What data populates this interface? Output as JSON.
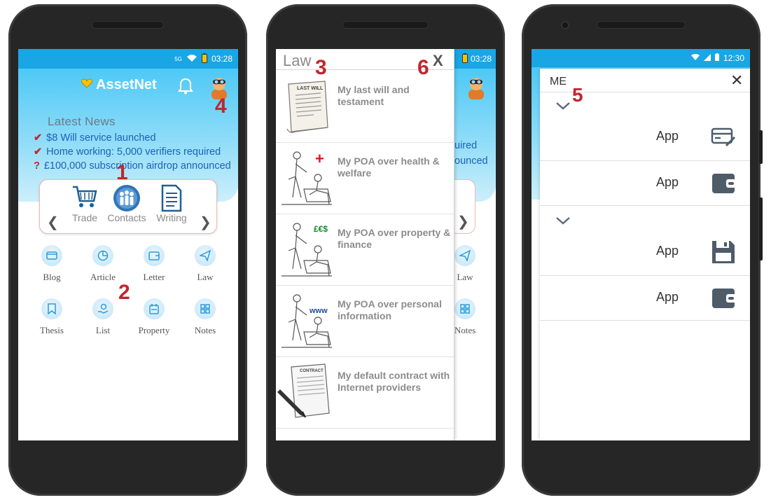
{
  "phone1": {
    "status": {
      "network": "5G",
      "time": "03:28"
    },
    "header": {
      "app_name": "AssetNet"
    },
    "news": {
      "title": "Latest News",
      "items": [
        {
          "marker": "✔",
          "text": "$8 Will service launched"
        },
        {
          "marker": "✔",
          "text": "Home working: 5,000 verifiers required"
        },
        {
          "marker": "?",
          "text": "£100,000 subscription airdrop announced"
        }
      ]
    },
    "carousel": {
      "items": [
        "Trade",
        "Contacts",
        "Writing"
      ],
      "prev": "❮",
      "next": "❯"
    },
    "grid": [
      "Blog",
      "Article",
      "Letter",
      "Law",
      "Thesis",
      "List",
      "Property",
      "Notes"
    ],
    "callouts": {
      "one": "1",
      "two": "2",
      "four": "4"
    }
  },
  "phone2": {
    "status": {
      "time": "03:28"
    },
    "drawer": {
      "title": "Law",
      "close": "X"
    },
    "items": [
      "My last will and testament",
      "My POA over health & welfare",
      "My POA over property & finance",
      "My POA over personal information",
      "My default contract with Internet providers"
    ],
    "doc_label": "LAST WILL",
    "contract_label": "CONTRACT",
    "icons_text": {
      "cross": "+",
      "money": "£€$",
      "www": "www"
    },
    "bg_fragments": {
      "t1": "uired",
      "t2": "ounced",
      "law": "Law",
      "notes": "Notes",
      "next": "❯"
    },
    "callouts": {
      "three": "3",
      "six": "6"
    }
  },
  "phone3": {
    "status": {
      "time": "12:30"
    },
    "header": {
      "title": "ME",
      "close": "✕"
    },
    "apps": [
      "App",
      "App",
      "App",
      "App"
    ],
    "callouts": {
      "five": "5"
    }
  }
}
